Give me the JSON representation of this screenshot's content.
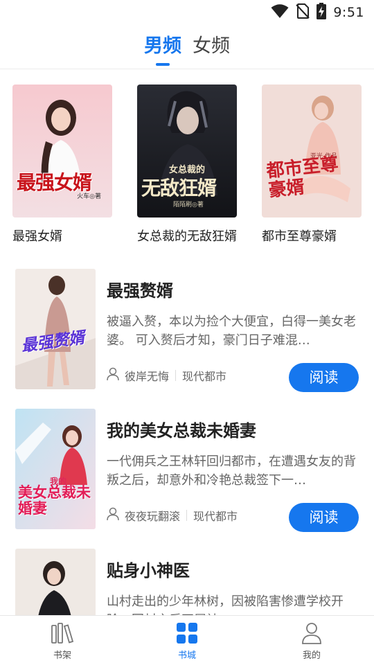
{
  "status_bar": {
    "time": "9:51",
    "icons": [
      "wifi-icon",
      "no-sim-icon",
      "battery-charging-icon"
    ]
  },
  "top_tabs": [
    {
      "label": "男频",
      "active": true
    },
    {
      "label": "女频",
      "active": false
    }
  ],
  "featured": [
    {
      "title": "最强女婿",
      "cover_text": "最强女婿",
      "cover_author": "火车◎著"
    },
    {
      "title": "女总裁的无敌狂婿",
      "cover_text": "无敌狂婿",
      "cover_subtext": "女总裁的",
      "cover_author": "陌陌刷◎著"
    },
    {
      "title": "都市至尊豪婿",
      "cover_text": "都市至尊豪婿",
      "cover_author": "亚光 作品"
    }
  ],
  "books": [
    {
      "title": "最强赘婿",
      "description": "被逼入赘，本以为捡个大便宜，白得一美女老婆。 可入赘后才知，豪门日子难混…",
      "author": "彼岸无悔",
      "category": "现代都市",
      "action_label": "阅读",
      "cover_text": "最强赘婿"
    },
    {
      "title": "我的美女总裁未婚妻",
      "description": "一代佣兵之王林轩回归都市，在遭遇女友的背叛之后，却意外和冷艳总裁签下一…",
      "author": "夜夜玩翻滚",
      "category": "现代都市",
      "action_label": "阅读",
      "cover_text": "美女总裁未婚妻",
      "cover_subtext": "我的"
    },
    {
      "title": "贴身小神医",
      "description": "山村走出的少年林树，因被陷害惨遭学校开除，回村之后再展神"
    }
  ],
  "bottom_nav": [
    {
      "label": "书架",
      "icon": "bookshelf-icon",
      "active": false
    },
    {
      "label": "书城",
      "icon": "bookstore-grid-icon",
      "active": true
    },
    {
      "label": "我的",
      "icon": "profile-icon",
      "active": false
    }
  ],
  "colors": {
    "accent": "#1677ee",
    "text_primary": "#222222",
    "text_secondary": "#666666"
  }
}
